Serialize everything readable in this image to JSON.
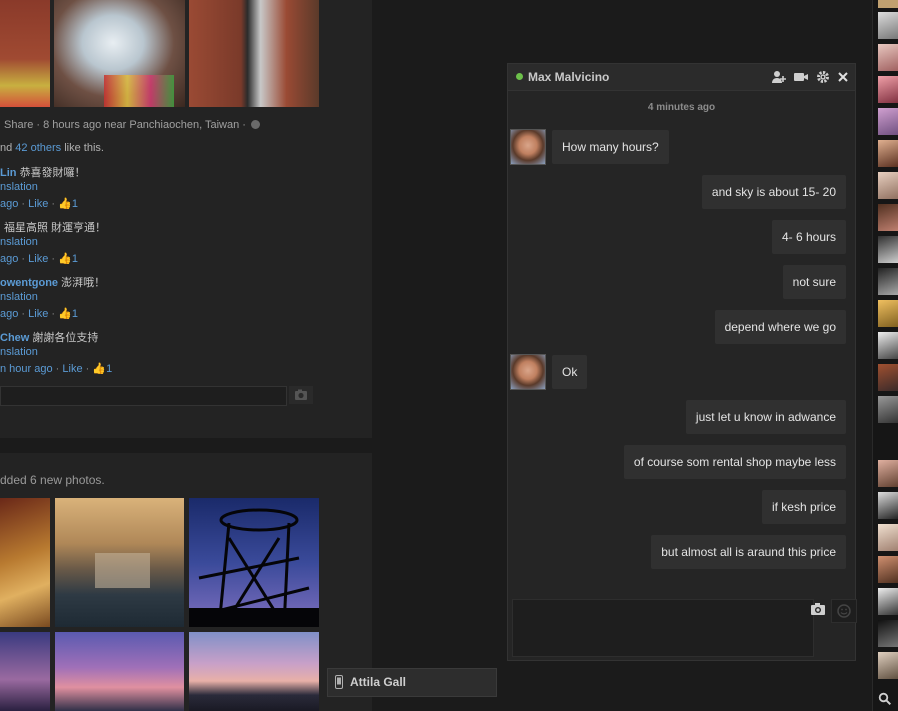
{
  "post1": {
    "meta_line": "Share · 8 hours ago near Panchiaochen, Taiwan ·",
    "likes_prefix": "nd ",
    "likes_link": "42 others",
    "likes_suffix": " like this.",
    "comments": [
      {
        "author": "Lin",
        "text": "恭喜發財囉！",
        "translation": "nslation",
        "time": "ago",
        "like": "Like",
        "count": "1"
      },
      {
        "author": "",
        "text": "福星高照 財運亨通！",
        "translation": "nslation",
        "time": "ago",
        "like": "Like",
        "count": "1"
      },
      {
        "author": "owentgone",
        "text": "澎湃哦！",
        "translation": "nslation",
        "time": "ago",
        "like": "Like",
        "count": "1"
      },
      {
        "author": "Chew",
        "text": "謝謝各位支持",
        "translation": "nslation",
        "time": "n hour ago",
        "like": "Like",
        "count": "1"
      }
    ]
  },
  "post2": {
    "text": "dded 6 new photos."
  },
  "chat": {
    "name": "Max Malvicino",
    "timestamp": "4 minutes ago",
    "messages": [
      {
        "side": "left",
        "text": "How many hours?"
      },
      {
        "side": "right",
        "text": "and sky is about 15- 20"
      },
      {
        "side": "right",
        "text": "4- 6 hours"
      },
      {
        "side": "right",
        "text": "not sure"
      },
      {
        "side": "right",
        "text": "depend where we go"
      },
      {
        "side": "left",
        "text": "Ok"
      },
      {
        "side": "right",
        "text": "just let u know in adwance"
      },
      {
        "side": "right",
        "text": "of course som rental shop maybe less"
      },
      {
        "side": "right",
        "text": "if kesh price"
      },
      {
        "side": "right",
        "text": "but almost all is araund this price"
      }
    ]
  },
  "chat_tab": {
    "name": "Attila Gall"
  },
  "colors": {
    "online": "#6cc04a",
    "link": "#5b9bd5"
  }
}
